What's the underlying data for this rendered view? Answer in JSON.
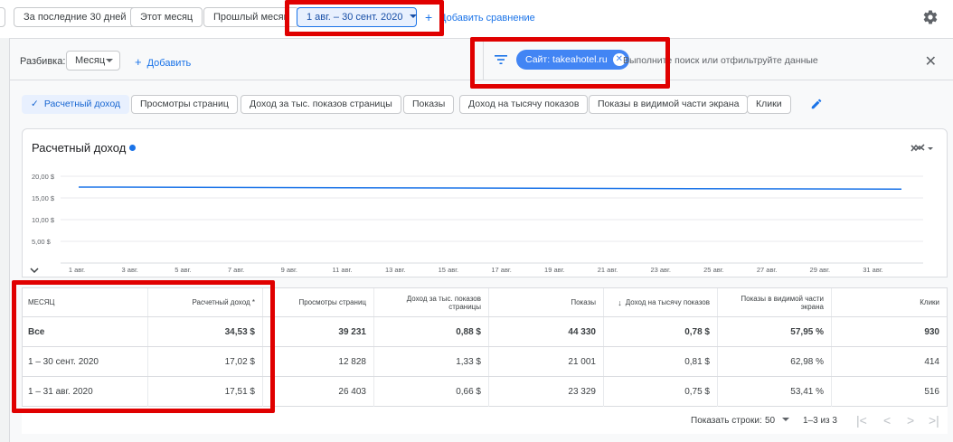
{
  "date_bar": {
    "presets": [
      "За последние 30 дней",
      "Этот месяц",
      "Прошлый месяц"
    ],
    "selected_range": "1 авг. – 30 сент. 2020",
    "add_comparison": "Добавить сравнение",
    "add_comparison_plus": "+"
  },
  "breakdown": {
    "label": "Разбивка:",
    "value": "Месяц",
    "add": "Добавить",
    "add_plus": "+"
  },
  "filter": {
    "chip_label": "Сайт: takeahotel.ru",
    "chip_close": "✕",
    "placeholder": "Выполните поиск или отфильтруйте данные",
    "close": "✕"
  },
  "metrics": [
    {
      "label": "Расчетный доход",
      "active": true,
      "check": "✓"
    },
    {
      "label": "Просмотры страниц",
      "active": false
    },
    {
      "label": "Доход за тыс. показов страницы",
      "active": false
    },
    {
      "label": "Показы",
      "active": false
    },
    {
      "label": "Доход на тысячу показов",
      "active": false
    },
    {
      "label": "Показы в видимой части экрана",
      "active": false
    },
    {
      "label": "Клики",
      "active": false
    }
  ],
  "chart_data": {
    "type": "line",
    "title": "Расчетный доход",
    "series_color": "#1a73e8",
    "y_ticks": [
      "20,00 $",
      "15,00 $",
      "10,00 $",
      "5,00 $"
    ],
    "y_tick_values": [
      20,
      15,
      10,
      5
    ],
    "ylim": [
      0,
      22.5
    ],
    "x_ticks": [
      "1 авг.",
      "3 авг.",
      "5 авг.",
      "7 авг.",
      "9 авг.",
      "11 авг.",
      "13 авг.",
      "15 авг.",
      "17 авг.",
      "19 авг.",
      "21 авг.",
      "23 авг.",
      "25 авг.",
      "27 авг.",
      "29 авг.",
      "31 авг."
    ],
    "series": [
      {
        "values": [
          17.51,
          17.02
        ]
      }
    ],
    "grid": true
  },
  "table": {
    "headers": [
      "МЕСЯЦ",
      "Расчетный доход *",
      "Просмотры страниц",
      "Доход за тыс. показов страницы",
      "Показы",
      "Доход на тысячу показов",
      "Показы в видимой части экрана",
      "Клики"
    ],
    "sort_arrow": "↓",
    "rows": [
      [
        "Все",
        "34,53 $",
        "39 231",
        "0,88 $",
        "44 330",
        "0,78 $",
        "57,95 %",
        "930"
      ],
      [
        "1 – 30 сент. 2020",
        "17,02 $",
        "12 828",
        "1,33 $",
        "21 001",
        "0,81 $",
        "62,98 %",
        "414"
      ],
      [
        "1 – 31 авг. 2020",
        "17,51 $",
        "26 403",
        "0,66 $",
        "23 329",
        "0,75 $",
        "53,41 %",
        "516"
      ]
    ]
  },
  "pagination": {
    "rows_label": "Показать строки:",
    "rows_value": "50",
    "range": "1–3 из 3",
    "first": "|<",
    "prev": "<",
    "next": ">",
    "last": ">|"
  },
  "colors": {
    "accent": "#1a73e8",
    "highlight": "#e00000"
  }
}
